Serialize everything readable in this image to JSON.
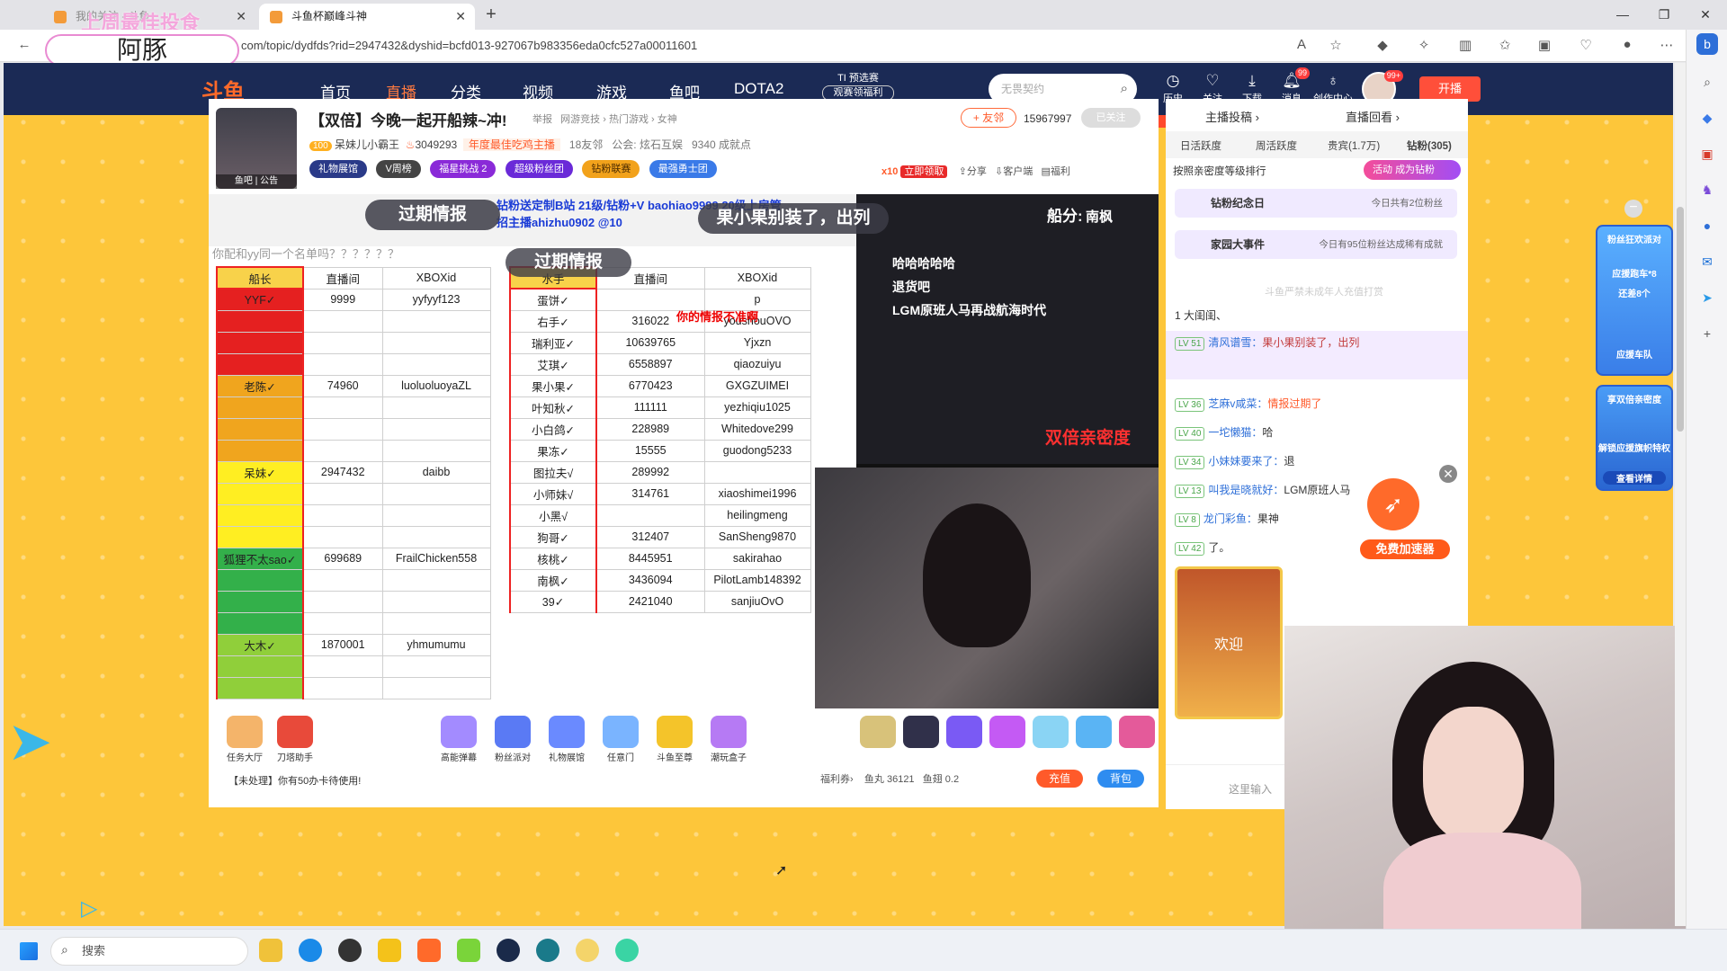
{
  "browser": {
    "tabs": [
      {
        "title": "我的关注 - 斗鱼",
        "active": false
      },
      {
        "title": "斗鱼杯巅峰斗神",
        "active": true
      }
    ],
    "tab_overlay_text": "上周最佳投食",
    "overlay_label": "阿豚",
    "url": "com/topic/dydfds?rid=2947432&dyshid=bcfd013-927067b983356eda0cfc527a00011601",
    "new_tab": "+",
    "window_controls": [
      "—",
      "❐",
      "✕"
    ]
  },
  "header": {
    "logo": "斗鱼",
    "menu": [
      {
        "label": "首页",
        "active": false
      },
      {
        "label": "直播",
        "active": true
      },
      {
        "label": "分类",
        "active": false
      },
      {
        "label": "视频",
        "active": false
      },
      {
        "label": "游戏",
        "active": false
      },
      {
        "label": "鱼吧",
        "active": false
      },
      {
        "label": "DOTA2",
        "active": false
      }
    ],
    "promo_line1": "TI 预选赛",
    "promo_line2": "观赛领福利",
    "search_placeholder": "无畏契约",
    "icons": [
      {
        "label": "历史",
        "icon": "history-icon",
        "badge": ""
      },
      {
        "label": "关注",
        "icon": "heart-icon",
        "badge": ""
      },
      {
        "label": "下载",
        "icon": "download-icon",
        "badge": ""
      },
      {
        "label": "消息",
        "icon": "bell-icon",
        "badge": "99"
      },
      {
        "label": "创作中心",
        "icon": "bulb-icon",
        "badge": ""
      }
    ],
    "avatar_badge": "99+",
    "broadcast_button": "开播"
  },
  "room": {
    "title": "【双倍】今晚一起开船辣~冲!",
    "report": "举报",
    "category": "网游竞技 › 热门游戏 › 女神",
    "add_friend": "+ 友邻",
    "fans": "15967997",
    "followed": "已关注",
    "anchor_name": "呆妹儿小霸王",
    "level": "100",
    "hot": "3049293",
    "award": "年度最佳吃鸡主播",
    "friends": "18友邻",
    "guild": "公会: 炫石互娱",
    "achievements": "9340 成就点",
    "avatar_caption": "鱼吧 | 公告",
    "pills": [
      "礼物展馆",
      "V周榜",
      "福星挑战 2",
      "超级粉丝团",
      "钻粉联赛",
      "最强勇士团"
    ],
    "promo_x10": "x10",
    "claim": "立即领取",
    "actions": [
      "分享",
      "客户端",
      "福利"
    ]
  },
  "video": {
    "danmu_top": "钻粉送定制B站 21级/钻粉+V baohiao9999 20级上房管",
    "danmu_top2": "招主播ahizhu0902 @10",
    "banner_expired": "过期情报",
    "banner_expired2": "过期情报",
    "banner_guo": "果小果别装了，出列",
    "qinmi_label": "船分:",
    "nanfeng": "南枫",
    "sheet_question": "你配和yy同一个名单吗？？？？？？",
    "expired_red": "你的情报不准啊",
    "dark_lines": [
      "哈哈哈哈哈",
      "退货吧",
      "LGM原班人马再战航海时代"
    ],
    "double_label": "双倍亲密度",
    "left_table": {
      "headers": [
        "船长",
        "直播间",
        "XBOXid"
      ],
      "rows": [
        [
          "YYF✓",
          "9999",
          "yyfyyf123"
        ],
        [
          "",
          "",
          ""
        ],
        [
          "",
          "",
          ""
        ],
        [
          "",
          "",
          ""
        ],
        [
          "老陈✓",
          "74960",
          "luoluoluoyaZL"
        ],
        [
          "",
          "",
          ""
        ],
        [
          "",
          "",
          ""
        ],
        [
          "",
          "",
          ""
        ],
        [
          "呆妹✓",
          "2947432",
          "daibb"
        ],
        [
          "",
          "",
          ""
        ],
        [
          "",
          "",
          ""
        ],
        [
          "",
          "",
          ""
        ],
        [
          "狐狸不太sao✓",
          "699689",
          "FrailChicken558"
        ],
        [
          "",
          "",
          ""
        ],
        [
          "",
          "",
          ""
        ],
        [
          "",
          "",
          ""
        ],
        [
          "大木✓",
          "1870001",
          "yhmumumu"
        ],
        [
          "",
          "",
          ""
        ],
        [
          "",
          "",
          ""
        ]
      ]
    },
    "right_table": {
      "headers": [
        "水手",
        "直播间",
        "XBOXid"
      ],
      "rows": [
        [
          "蛋饼✓",
          "",
          "p"
        ],
        [
          "右手✓",
          "316022",
          "youshouOVO"
        ],
        [
          "瑞利亚✓",
          "10639765",
          "Yjxzn"
        ],
        [
          "艾琪✓",
          "6558897",
          "qiaozuiyu"
        ],
        [
          "果小果✓",
          "6770423",
          "GXGZUIMEI"
        ],
        [
          "叶知秋✓",
          "111111",
          "yezhiqiu1025"
        ],
        [
          "小白鸽✓",
          "228989",
          "Whitedove299"
        ],
        [
          "果冻✓",
          "15555",
          "guodong5233"
        ],
        [
          "图拉夫√",
          "289992",
          ""
        ],
        [
          "小师妹√",
          "314761",
          "xiaoshimei1996"
        ],
        [
          "小黑√",
          "",
          "heilingmeng"
        ],
        [
          "狗哥✓",
          "312407",
          "SanSheng9870"
        ],
        [
          "核桃✓",
          "8445951",
          "sakirahao"
        ],
        [
          "南枫✓",
          "3436094",
          "PilotLamb148392"
        ],
        [
          "39✓",
          "2421040",
          "sanjiuOvO"
        ]
      ]
    }
  },
  "giftbar": {
    "gifts": [
      "任务大厅",
      "刀塔助手",
      "高能弹幕",
      "粉丝派对",
      "礼物展馆",
      "任意门",
      "斗鱼至尊",
      "潮玩盒子"
    ],
    "notice": "【未处理】你有50办卡待使用!",
    "welfare": "福利券›",
    "yuwan": "鱼丸 36121",
    "yuchi": "鱼翅 0.2",
    "recharge": "充值",
    "bag": "背包"
  },
  "chat": {
    "top_left": "主播投稿 ›",
    "top_right": "直播回看 ›",
    "tabs": [
      "日活跃度",
      "周活跃度",
      "贵宾(1.7万)",
      "钻粉(305)"
    ],
    "rank_header": "按照亲密度等级排行",
    "activity": "活动",
    "activity_sub": "成为钻粉",
    "card1_title": "钻粉纪念日",
    "card1_right": "今日共有2位粉丝",
    "card2_title": "家园大事件",
    "card2_right": "今日有95位粉丝达成稀有成就",
    "hint": "斗鱼严禁未成年人充值打赏",
    "rank_row": "1  大闺闺、",
    "messages": [
      {
        "lv": "LV 51",
        "nick": "清风谱雪：",
        "text": "果小果别装了，出列"
      },
      {
        "lv": "LV 36",
        "nick": "芝麻v咸菜：",
        "text": "情报过期了"
      },
      {
        "lv": "LV 40",
        "nick": "一坨懒猫：",
        "text": "哈"
      },
      {
        "lv": "LV 34",
        "nick": "小妹妹要来了：",
        "text": "退"
      },
      {
        "lv": "LV 13",
        "nick": "叫我是晓就好：",
        "text": "LGM原班人马"
      },
      {
        "lv": "LV 8",
        "nick": "龙门彩鱼：",
        "text": "果神"
      },
      {
        "lv": "LV 42",
        "nick": "",
        "text": "了。"
      }
    ],
    "welcome": "欢迎",
    "input_placeholder": "这里输入"
  },
  "floating": {
    "boost_label": "免费加速器",
    "boost_close": "✕",
    "sidead1_top": "粉丝狂欢派对",
    "sidead1_mid": "应援跑车*8",
    "sidead1_sub": "还差8个",
    "sidead1_bottom": "应援车队",
    "sidead2_top": "享双倍亲密度",
    "sidead2_mid": "解锁应援旗帜特权",
    "sidead2_bottom": "查看详情"
  },
  "taskbar": {
    "search": "搜索"
  },
  "colors": {
    "page_bg": "#fdc63a",
    "header_bg": "#1b2a55",
    "accent": "#ff5a2a"
  }
}
